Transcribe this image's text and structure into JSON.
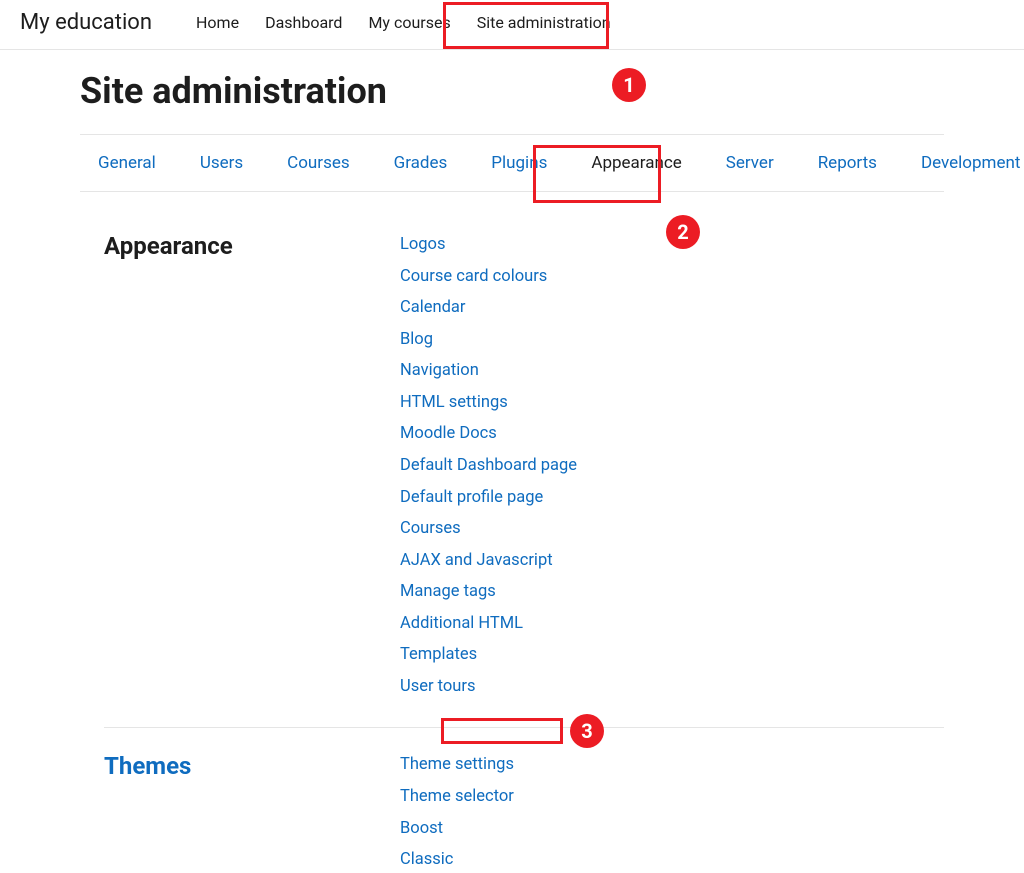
{
  "brand": "My education",
  "topnav": {
    "home": "Home",
    "dashboard": "Dashboard",
    "mycourses": "My courses",
    "siteadmin": "Site administration"
  },
  "page_title": "Site administration",
  "tabs": {
    "general": "General",
    "users": "Users",
    "courses": "Courses",
    "grades": "Grades",
    "plugins": "Plugins",
    "appearance": "Appearance",
    "server": "Server",
    "reports": "Reports",
    "development": "Development"
  },
  "sections": {
    "appearance": {
      "heading": "Appearance",
      "links": {
        "logos": "Logos",
        "course_card_colours": "Course card colours",
        "calendar": "Calendar",
        "blog": "Blog",
        "navigation": "Navigation",
        "html_settings": "HTML settings",
        "moodle_docs": "Moodle Docs",
        "default_dashboard": "Default Dashboard page",
        "default_profile": "Default profile page",
        "courses": "Courses",
        "ajax_js": "AJAX and Javascript",
        "manage_tags": "Manage tags",
        "additional_html": "Additional HTML",
        "templates": "Templates",
        "user_tours": "User tours"
      }
    },
    "themes": {
      "heading": "Themes",
      "links": {
        "theme_settings": "Theme settings",
        "theme_selector": "Theme selector",
        "boost": "Boost",
        "classic": "Classic"
      }
    }
  },
  "annotations": {
    "one": "1",
    "two": "2",
    "three": "3"
  }
}
